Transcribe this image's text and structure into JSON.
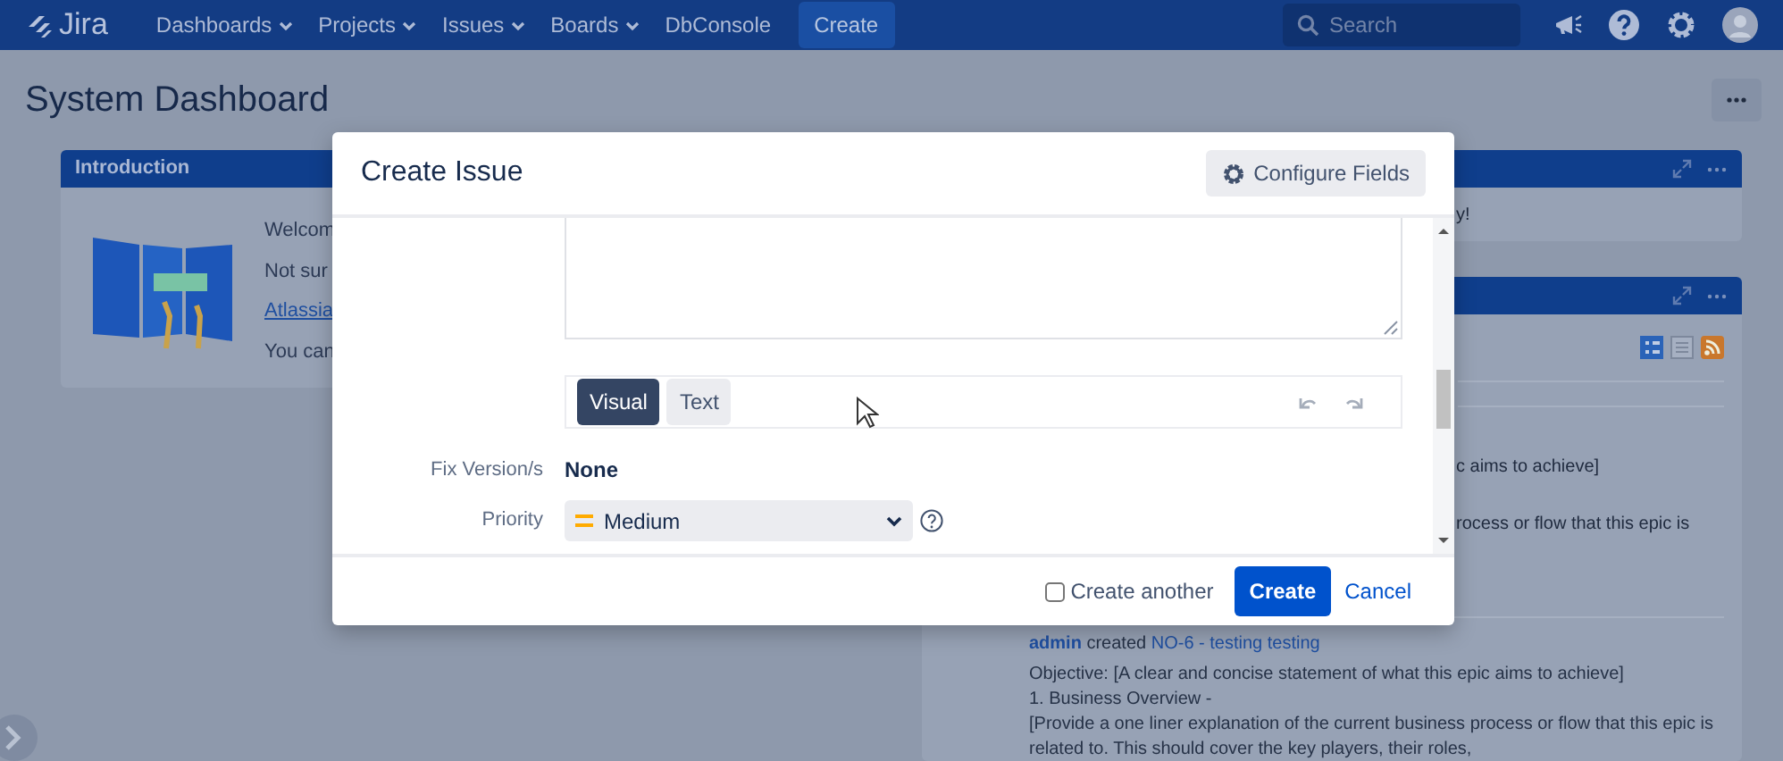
{
  "navbar": {
    "logo": "Jira",
    "menus": [
      {
        "label": "Dashboards",
        "dropdown": true
      },
      {
        "label": "Projects",
        "dropdown": true
      },
      {
        "label": "Issues",
        "dropdown": true
      },
      {
        "label": "Boards",
        "dropdown": true
      },
      {
        "label": "DbConsole",
        "dropdown": false
      }
    ],
    "create_button": "Create",
    "search": {
      "placeholder": "Search"
    }
  },
  "page": {
    "title": "System Dashboard"
  },
  "introduction_gadget": {
    "title": "Introduction",
    "lines": [
      {
        "kind": "text",
        "text": "Welcom"
      },
      {
        "kind": "text",
        "text": "Not sur"
      },
      {
        "kind": "link",
        "text": "Atlassia"
      },
      {
        "kind": "text",
        "text": "You can"
      }
    ]
  },
  "right_gadgets": [
    {
      "fragments": [
        "y!"
      ]
    },
    {
      "fragments": [
        "c aims to achieve]",
        "rocess or flow that this epic is"
      ],
      "activity": {
        "user": "admin",
        "action": "created",
        "issue": "NO-6 - testing testing",
        "lines": [
          "Objective: [A clear and concise statement of what this epic aims to achieve]",
          "1. Business Overview -",
          "[Provide a one liner explanation of the current business process or flow that this epic is related to. This should cover the key players, their roles,"
        ]
      }
    }
  ],
  "dialog": {
    "title": "Create Issue",
    "configure_button": "Configure Fields",
    "editor_tabs": [
      {
        "label": "Visual",
        "selected": true
      },
      {
        "label": "Text",
        "selected": false
      }
    ],
    "fields": [
      {
        "kind": "static",
        "label": "Fix Version/s",
        "value": "None"
      },
      {
        "kind": "select",
        "label": "Priority",
        "value": "Medium"
      }
    ],
    "create_another": {
      "label": "Create another",
      "checked": false
    },
    "submit": "Create",
    "cancel": "Cancel"
  }
}
